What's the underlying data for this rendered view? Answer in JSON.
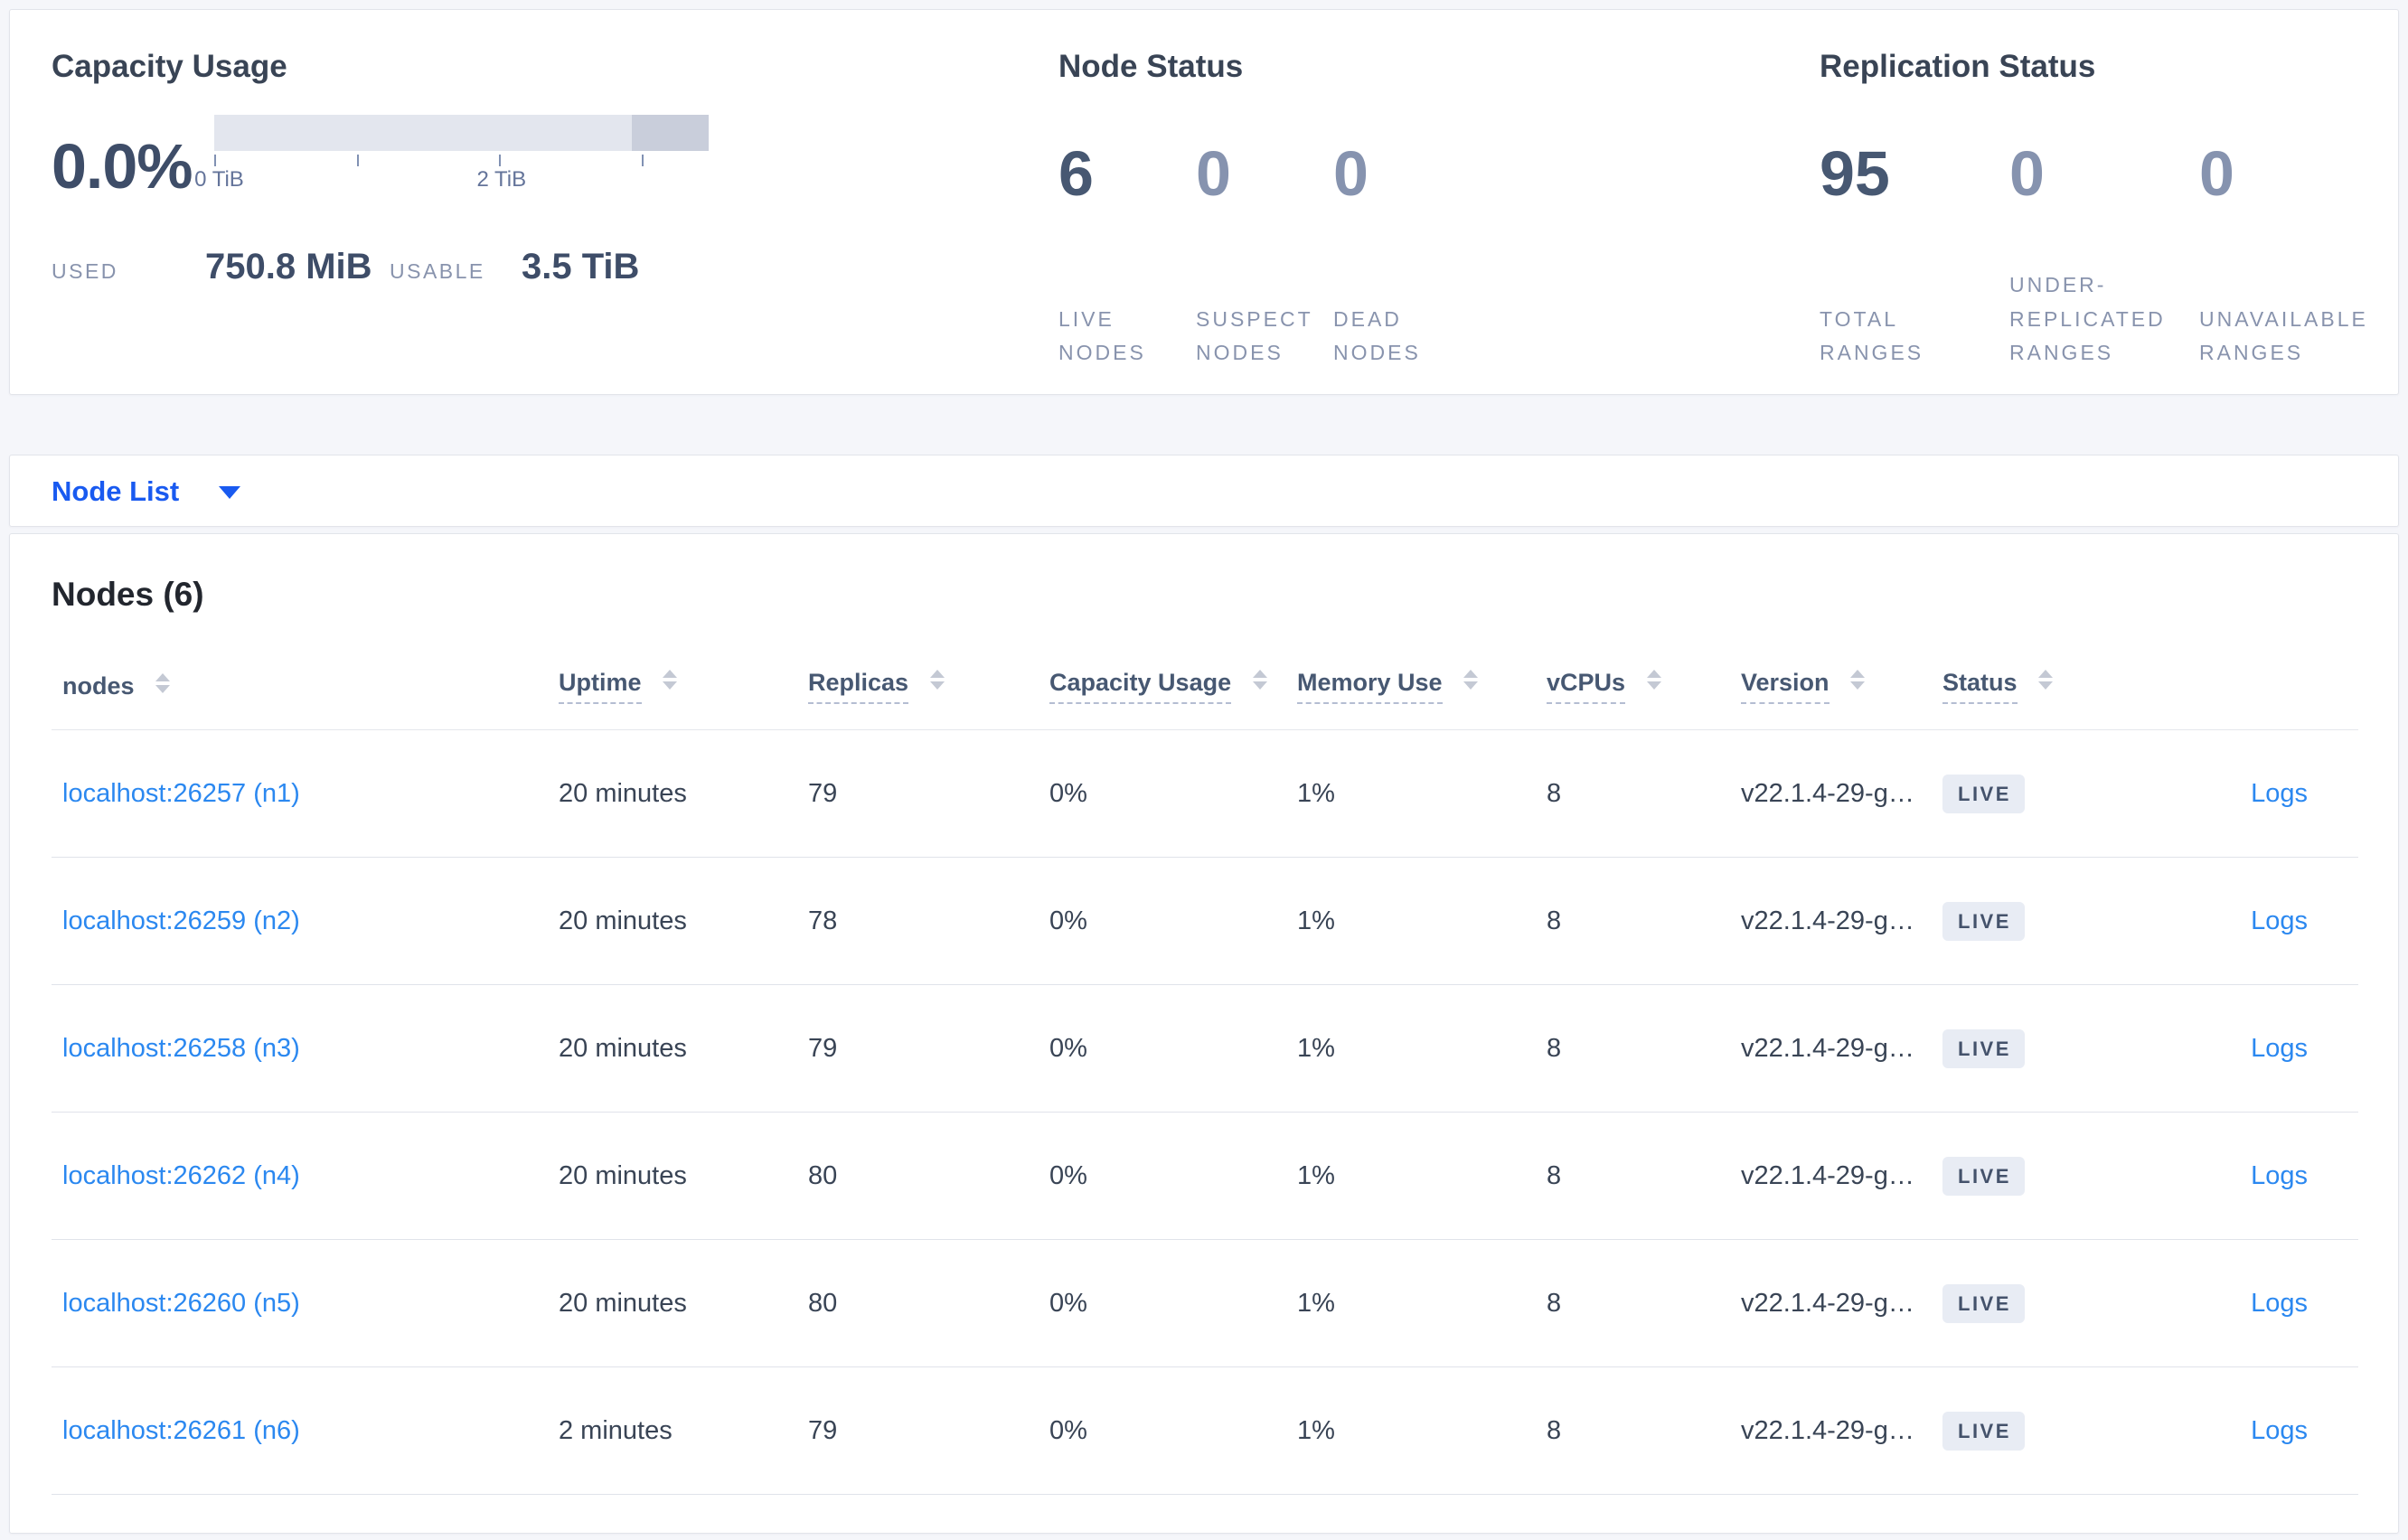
{
  "colors": {
    "accent_blue": "#195af0",
    "link_blue": "#2b88f0",
    "stat_dark": "#475872",
    "stat_muted": "#8693af",
    "badge_bg": "#e8ecf4"
  },
  "capacity_panel": {
    "title": "Capacity Usage",
    "percent": "0.0%",
    "gauge": {
      "used_fraction": 0.0,
      "dark_segment_start_fraction": 0.845,
      "axis_ticks_tib": [
        0,
        1,
        2,
        3
      ],
      "axis_labels": {
        "tick0": "0 TiB",
        "tick2": "2 TiB"
      }
    },
    "used_label": "USED",
    "used_value": "750.8 MiB",
    "usable_label": "USABLE",
    "usable_value": "3.5 TiB"
  },
  "node_status_panel": {
    "title": "Node Status",
    "stats": [
      {
        "value": "6",
        "label": "LIVE NODES"
      },
      {
        "value": "0",
        "label": "SUSPECT NODES"
      },
      {
        "value": "0",
        "label": "DEAD NODES"
      }
    ]
  },
  "replication_panel": {
    "title": "Replication Status",
    "stats": [
      {
        "value": "95",
        "label": "TOTAL RANGES"
      },
      {
        "value": "0",
        "label": "UNDER-REPLICATED RANGES"
      },
      {
        "value": "0",
        "label": "UNAVAILABLE RANGES"
      }
    ]
  },
  "node_list_dropdown": {
    "label": "Node List"
  },
  "nodes_section": {
    "title": "Nodes (6)",
    "columns": [
      "nodes",
      "Uptime",
      "Replicas",
      "Capacity Usage",
      "Memory Use",
      "vCPUs",
      "Version",
      "Status"
    ],
    "rows": [
      {
        "node": "localhost:26257 (n1)",
        "uptime": "20 minutes",
        "replicas": "79",
        "capacity": "0%",
        "memory": "1%",
        "vcpus": "8",
        "version": "v22.1.4-29-g…",
        "status": "LIVE",
        "logs_label": "Logs"
      },
      {
        "node": "localhost:26259 (n2)",
        "uptime": "20 minutes",
        "replicas": "78",
        "capacity": "0%",
        "memory": "1%",
        "vcpus": "8",
        "version": "v22.1.4-29-g…",
        "status": "LIVE",
        "logs_label": "Logs"
      },
      {
        "node": "localhost:26258 (n3)",
        "uptime": "20 minutes",
        "replicas": "79",
        "capacity": "0%",
        "memory": "1%",
        "vcpus": "8",
        "version": "v22.1.4-29-g…",
        "status": "LIVE",
        "logs_label": "Logs"
      },
      {
        "node": "localhost:26262 (n4)",
        "uptime": "20 minutes",
        "replicas": "80",
        "capacity": "0%",
        "memory": "1%",
        "vcpus": "8",
        "version": "v22.1.4-29-g…",
        "status": "LIVE",
        "logs_label": "Logs"
      },
      {
        "node": "localhost:26260 (n5)",
        "uptime": "20 minutes",
        "replicas": "80",
        "capacity": "0%",
        "memory": "1%",
        "vcpus": "8",
        "version": "v22.1.4-29-g…",
        "status": "LIVE",
        "logs_label": "Logs"
      },
      {
        "node": "localhost:26261 (n6)",
        "uptime": "2 minutes",
        "replicas": "79",
        "capacity": "0%",
        "memory": "1%",
        "vcpus": "8",
        "version": "v22.1.4-29-g…",
        "status": "LIVE",
        "logs_label": "Logs"
      }
    ]
  }
}
